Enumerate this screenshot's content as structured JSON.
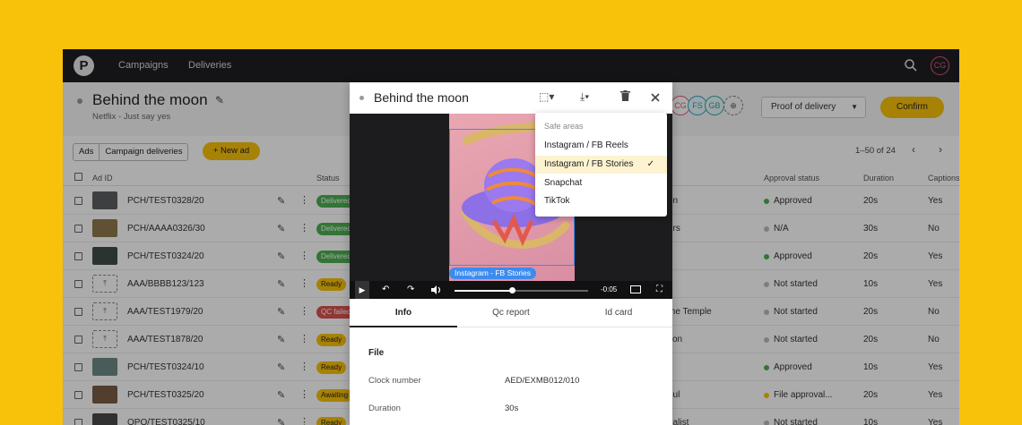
{
  "nav": {
    "items": [
      "Campaigns",
      "Deliveries"
    ],
    "user_initials": "CG"
  },
  "header": {
    "title": "Behind the moon",
    "subtitle": "Netflix - Just say yes",
    "proof_select": "Proof of delivery",
    "confirm_label": "Confirm",
    "avatars": [
      {
        "initials": "CG",
        "color": "#e0596f"
      },
      {
        "initials": "FS",
        "color": "#1ea6c6"
      },
      {
        "initials": "GB",
        "color": "#2aa8a0"
      }
    ]
  },
  "toolbar": {
    "segments": [
      "Ads",
      "Campaign deliveries"
    ],
    "new_ad_label": "+ New ad",
    "pager": "1–50 of 24"
  },
  "table": {
    "headers": [
      "Ad ID",
      "Status",
      "Approval status",
      "Duration",
      "Captions"
    ],
    "rows": [
      {
        "ad_id": "PCH/TEST0328/20",
        "status": "Delivered",
        "status_type": "delivered",
        "title_frag": "on",
        "approval": "Approved",
        "approval_color": "#4caf50",
        "duration": "20s",
        "captions": "Yes",
        "thumb": "#5b5e62"
      },
      {
        "ad_id": "PCH/AAAA0326/30",
        "status": "Delivered",
        "status_type": "delivered",
        "title_frag": "urs",
        "approval": "N/A",
        "approval_color": "#bbbbbb",
        "duration": "30s",
        "captions": "No",
        "thumb": "#8f7a4e"
      },
      {
        "ad_id": "PCH/TEST0324/20",
        "status": "Delivered",
        "status_type": "delivered",
        "title_frag": "",
        "approval": "Approved",
        "approval_color": "#4caf50",
        "duration": "20s",
        "captions": "Yes",
        "thumb": "#3f4d48"
      },
      {
        "ad_id": "AAA/BBBB123/123",
        "status": "Ready",
        "status_type": "ready",
        "title_frag": "",
        "approval": "Not started",
        "approval_color": "#bbbbbb",
        "duration": "10s",
        "captions": "Yes",
        "thumb": ""
      },
      {
        "ad_id": "AAA/TEST1979/20",
        "status": "QC failed",
        "status_type": "qc",
        "title_frag": "the Temple",
        "approval": "Not started",
        "approval_color": "#bbbbbb",
        "duration": "20s",
        "captions": "No",
        "thumb": ""
      },
      {
        "ad_id": "AAA/TEST1878/20",
        "status": "Ready",
        "status_type": "ready",
        "title_frag": "tion",
        "approval": "Not started",
        "approval_color": "#bbbbbb",
        "duration": "20s",
        "captions": "No",
        "thumb": ""
      },
      {
        "ad_id": "PCH/TEST0324/10",
        "status": "Ready",
        "status_type": "ready",
        "title_frag": "",
        "approval": "Approved",
        "approval_color": "#4caf50",
        "duration": "10s",
        "captions": "Yes",
        "thumb": "#6e8a86"
      },
      {
        "ad_id": "PCH/TEST0325/20",
        "status": "Awaiting",
        "status_type": "awaiting",
        "title_frag": "oul",
        "approval": "File approval...",
        "approval_color": "#f9c20a",
        "duration": "20s",
        "captions": "Yes",
        "thumb": "#7a5d46"
      },
      {
        "ad_id": "OPO/TEST0325/10",
        "status": "Ready",
        "status_type": "ready",
        "title_frag": "nalist",
        "approval": "Not started",
        "approval_color": "#bbbbbb",
        "duration": "10s",
        "captions": "Yes",
        "thumb": "#4a4a4a"
      }
    ]
  },
  "modal": {
    "title": "Behind the moon",
    "safe_area_label": "Instagram - FB Stories",
    "time": "-0:05",
    "progress": 0.43,
    "tabs": [
      "Info",
      "Qc report",
      "Id card"
    ],
    "section_title": "File",
    "fields": [
      {
        "key": "Clock number",
        "value": "AED/EXMB012/010"
      },
      {
        "key": "Duration",
        "value": "30s"
      }
    ]
  },
  "safe_areas": {
    "heading": "Safe areas",
    "options": [
      "Instagram / FB Reels",
      "Instagram / FB Stories",
      "Snapchat",
      "TikTok"
    ],
    "selected": "Instagram / FB Stories"
  }
}
